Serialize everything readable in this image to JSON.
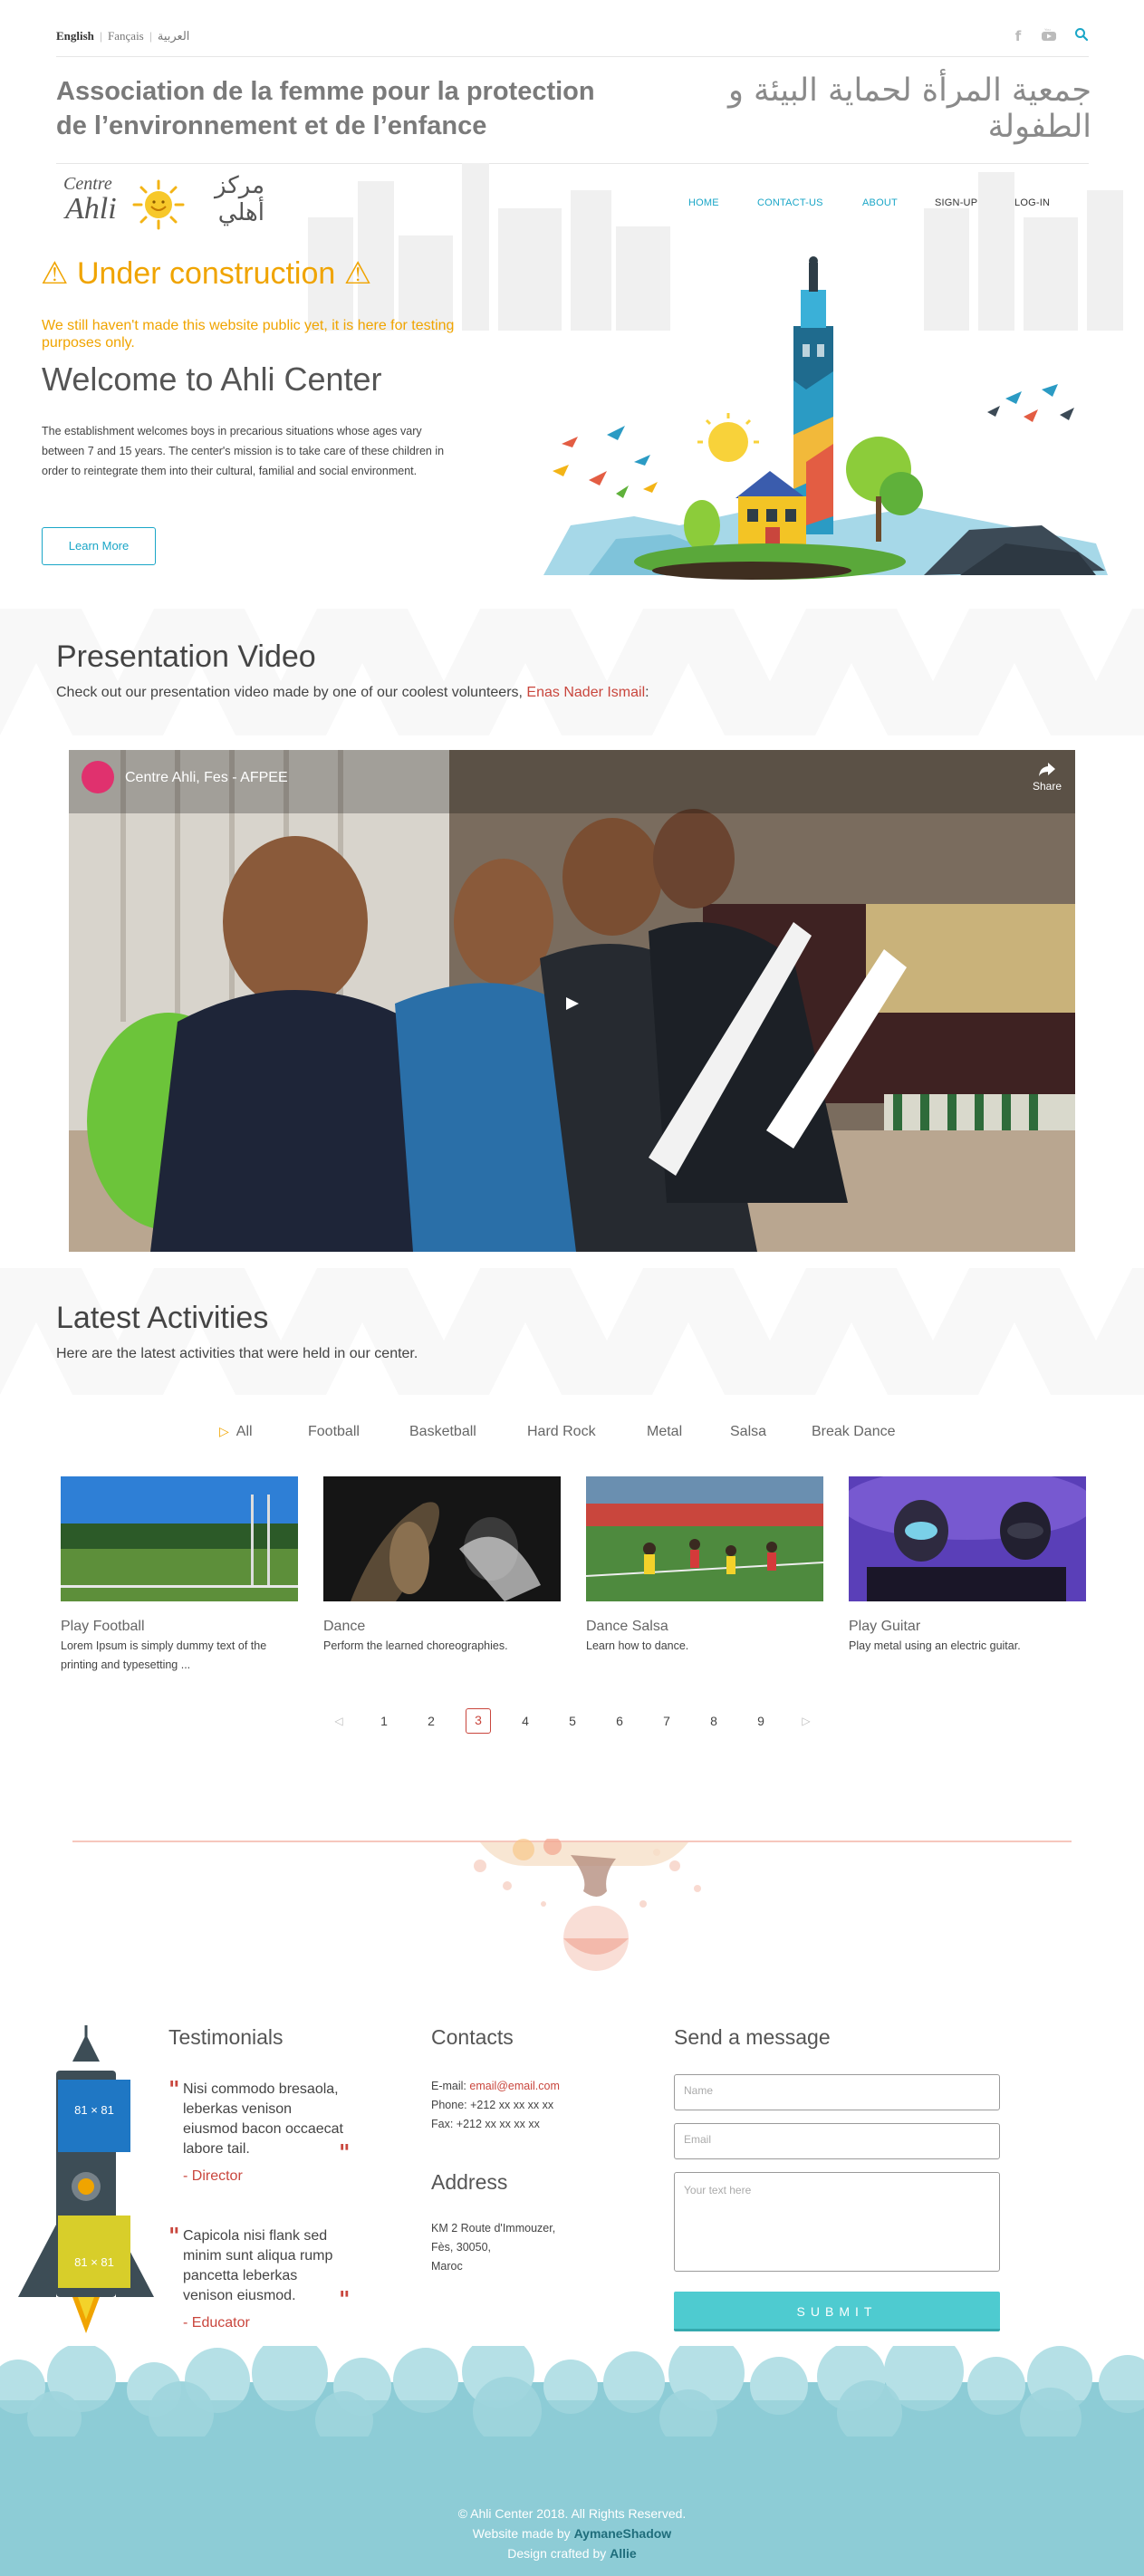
{
  "languages": {
    "english": "English",
    "sep": "|",
    "francais": "Fançais",
    "arabic": "العربية"
  },
  "association": {
    "name_fr": "Association de la femme pour la protection de l’environnement et de l’enfance",
    "name_ar": "جمعية المرأة لحماية البيئة و الطفولة"
  },
  "logo": {
    "centre": "Centre",
    "ahli": "Ahli",
    "arabic": "مركز أهلي"
  },
  "nav": {
    "home": "HOME",
    "contact": "CONTACT-US",
    "about": "ABOUT",
    "signup": "SIGN-UP",
    "login": "LOG-IN"
  },
  "hero": {
    "warn_icon": "⚠",
    "uc_title": "Under construction",
    "uc_sub": "We still haven't made this website public yet, it is here for testing purposes only.",
    "welcome": "Welcome to Ahli Center",
    "text": "The establishment welcomes boys in precarious situations whose ages vary between 7 and 15 years. The center's mission is to take care of these children in order to reintegrate them into their cultural, familial and social environment.",
    "button": "Learn More"
  },
  "video": {
    "title": "Presentation Video",
    "desc_pre": "Check out our presentation video made by one of our coolest volunteers, ",
    "volunteer": "Enas Nader Ismail",
    "desc_post": ":",
    "player_title": "Centre Ahli, Fes - AFPEE",
    "share": "Share"
  },
  "activities": {
    "title": "Latest Activities",
    "desc": "Here are the latest activities that were held in our center.",
    "filters": [
      "All",
      "Football",
      "Basketball",
      "Hard Rock",
      "Metal",
      "Salsa",
      "Break Dance"
    ],
    "cards": [
      {
        "title": "Play Football",
        "desc": "Lorem Ipsum is simply dummy text of the printing and typesetting ..."
      },
      {
        "title": "Dance",
        "desc": "Perform the learned choreographies."
      },
      {
        "title": "Dance Salsa",
        "desc": "Learn how to dance."
      },
      {
        "title": "Play Guitar",
        "desc": "Play metal using an electric guitar."
      }
    ],
    "pages": [
      "1",
      "2",
      "3",
      "4",
      "5",
      "6",
      "7",
      "8",
      "9"
    ],
    "current_page": "3",
    "prev": "◁",
    "next": "▷"
  },
  "testimonials": {
    "title": "Testimonials",
    "items": [
      {
        "text": "Nisi commodo bresaola, leberkas venison eiusmod bacon occaecat labore tail.",
        "author": "- Director"
      },
      {
        "text": "Capicola nisi flank sed minim sunt aliqua rump pancetta leberkas venison eiusmod.",
        "author": "- Educator"
      }
    ],
    "placeholder_label": "81 × 81"
  },
  "contacts": {
    "title": "Contacts",
    "email_label": "E-mail: ",
    "email": "email@email.com",
    "phone": "Phone: +212 xx xx xx xx",
    "fax": "Fax: +212 xx xx xx xx",
    "address_title": "Address",
    "address_lines": [
      "KM 2 Route d'Immouzer,",
      "Fès, 30050,",
      "Maroc"
    ]
  },
  "message": {
    "title": "Send a message",
    "name_placeholder": "Name",
    "email_placeholder": "Email",
    "text_placeholder": "Your text here",
    "submit": "SUBMIT"
  },
  "footer": {
    "copyright": "© Ahli Center 2018. All Rights Reserved.",
    "made_by": "Website made by ",
    "made_by_name": "AymaneShadow",
    "design_by": "Design crafted by ",
    "design_by_name": "Allie"
  },
  "colors": {
    "accent": "#1aa6c7",
    "warning": "#f0a400",
    "red": "#c9463d",
    "teal": "#4ecbd0",
    "footer": "#8dccd6"
  }
}
